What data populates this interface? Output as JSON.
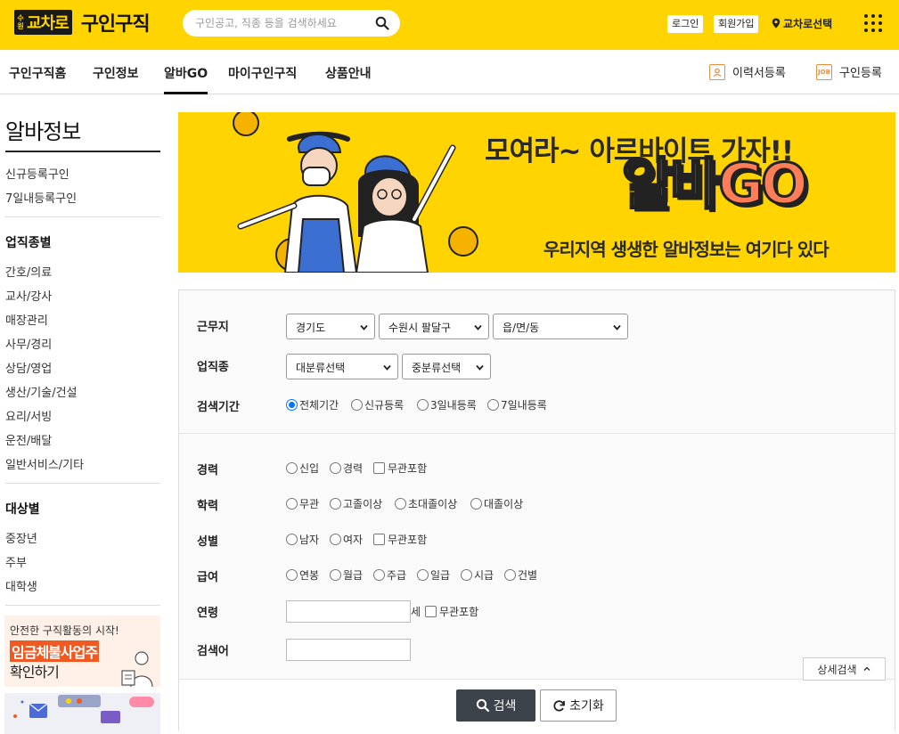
{
  "header": {
    "logo_small": "수원",
    "logo_brand": "교차로",
    "logo_title": "구인구직",
    "search_placeholder": "구인공고, 직종 등을 검색하세요",
    "login": "로그인",
    "signup": "회원가입",
    "location": "교차로선택"
  },
  "nav": {
    "items": [
      "구인구직홈",
      "구인정보",
      "알바GO",
      "마이구인구직",
      "상품안내"
    ],
    "resume": "이력서등록",
    "job_post": "구인등록",
    "job_icon_text": "JOB"
  },
  "sidebar": {
    "title": "알바정보",
    "top_links": [
      "신규등록구인",
      "7일내등록구인"
    ],
    "section1_title": "업직종별",
    "section1_links": [
      "간호/의료",
      "교사/강사",
      "매장관리",
      "사무/경리",
      "상담/영업",
      "생산/기술/건설",
      "요리/서빙",
      "운전/배달",
      "일반서비스/기타"
    ],
    "section2_title": "대상별",
    "section2_links": [
      "중장년",
      "주부",
      "대학생"
    ],
    "ad_line1": "안전한 구직활동의 시작!",
    "ad_line2": "임금체불사업주",
    "ad_line3": "확인하기"
  },
  "banner": {
    "line1": "모여라~ 아르바이트 가자!!",
    "big_a": "알바",
    "big_b": "GO",
    "line3": "우리지역 생생한 알바정보는 여기다 있다"
  },
  "form": {
    "work_location": {
      "label": "근무지",
      "province": "경기도",
      "city": "수원시 팔달구",
      "town": "읍/면/동"
    },
    "job_type": {
      "label": "업직종",
      "major": "대분류선택",
      "minor": "중분류선택"
    },
    "period": {
      "label": "검색기간",
      "options": [
        "전체기간",
        "신규등록",
        "3일내등록",
        "7일내등록"
      ]
    },
    "career": {
      "label": "경력",
      "options": [
        "신입",
        "경력"
      ],
      "check": "무관포함"
    },
    "education": {
      "label": "학력",
      "options": [
        "무관",
        "고졸이상",
        "초대졸이상",
        "대졸이상"
      ]
    },
    "gender": {
      "label": "성별",
      "options": [
        "남자",
        "여자"
      ],
      "check": "무관포함"
    },
    "salary": {
      "label": "급여",
      "options": [
        "연봉",
        "월급",
        "주급",
        "일급",
        "시급",
        "건별"
      ]
    },
    "age": {
      "label": "연령",
      "unit": "세",
      "check": "무관포함"
    },
    "keyword": {
      "label": "검색어"
    },
    "search_button": "검색",
    "reset_button": "초기화",
    "detail_button": "상세검색"
  }
}
